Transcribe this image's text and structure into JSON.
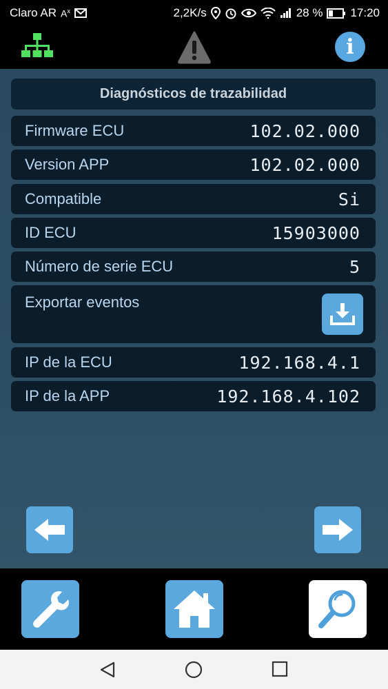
{
  "status_bar": {
    "carrier": "Claro AR",
    "speed": "2,2K/s",
    "battery": "28 %",
    "time": "17:20"
  },
  "header": {
    "icons": [
      "network-tree-icon",
      "warning-icon",
      "info-icon"
    ],
    "info_glyph": "i"
  },
  "panel": {
    "title": "Diagnósticos de trazabilidad",
    "rows": [
      {
        "label": "Firmware ECU",
        "value": "102.02.000"
      },
      {
        "label": "Version APP",
        "value": "102.02.000"
      },
      {
        "label": "Compatible",
        "value": "Si"
      },
      {
        "label": "ID ECU",
        "value": "15903000"
      },
      {
        "label": "Número de serie ECU",
        "value": "5"
      },
      {
        "label": "Exportar eventos",
        "value": ""
      },
      {
        "label": "IP de la ECU",
        "value": "192.168.4.1"
      },
      {
        "label": "IP de la APP",
        "value": "192.168.4.102"
      }
    ]
  },
  "navigation": {
    "back_icon": "arrow-left-icon",
    "forward_icon": "arrow-right-icon"
  },
  "toolbar": {
    "buttons": [
      "wrench-icon",
      "home-icon",
      "magnifier-icon"
    ],
    "active": "magnifier-icon"
  },
  "colors": {
    "accent": "#5aa8de",
    "row_bg": "#0b1d2b",
    "label": "#b9d6ee",
    "content_bg": "#2d4d63"
  }
}
